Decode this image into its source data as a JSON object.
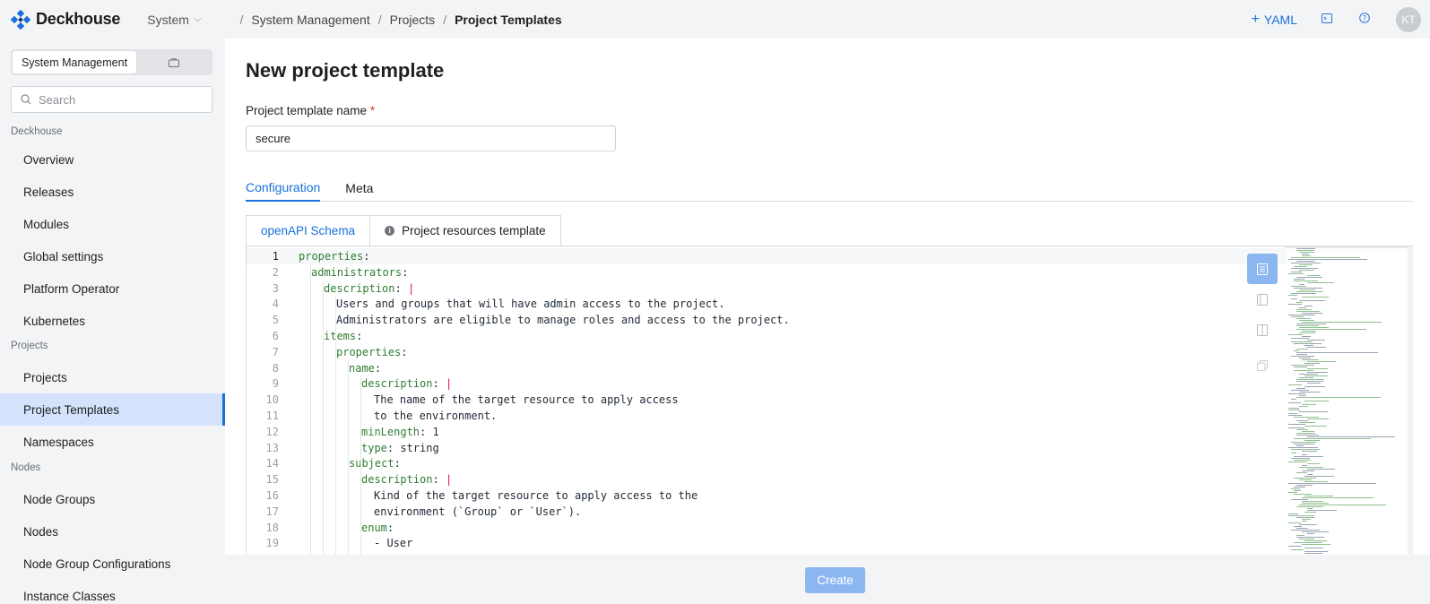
{
  "header": {
    "logo_text": "Deckhouse",
    "system_select": "System",
    "breadcrumbs": [
      "System Management",
      "Projects",
      "Project Templates"
    ],
    "yaml_label": "YAML",
    "avatar_initials": "KT"
  },
  "sidebar": {
    "segment_active": "System Management",
    "search_placeholder": "Search",
    "sections": {
      "deckhouse": "Deckhouse",
      "projects": "Projects",
      "nodes": "Nodes"
    },
    "items": {
      "overview": "Overview",
      "releases": "Releases",
      "modules": "Modules",
      "global_settings": "Global settings",
      "platform_operator": "Platform Operator",
      "kubernetes": "Kubernetes",
      "projects": "Projects",
      "project_templates": "Project Templates",
      "namespaces": "Namespaces",
      "node_groups": "Node Groups",
      "nodes": "Nodes",
      "node_group_configurations": "Node Group Configurations",
      "instance_classes": "Instance Classes"
    },
    "active_item": "Project Templates"
  },
  "main": {
    "title": "New project template",
    "name_label": "Project template name",
    "name_required_mark": "*",
    "name_value": "secure",
    "tabs": [
      "Configuration",
      "Meta"
    ],
    "active_tab": "Configuration",
    "subtabs": [
      "openAPI Schema",
      "Project resources template"
    ],
    "active_subtab": "openAPI Schema",
    "info_glyph": "i"
  },
  "editor": {
    "lines": [
      {
        "n": "1",
        "indent": 0,
        "key": "properties",
        "rest": "",
        "pipe": false,
        "plain": ""
      },
      {
        "n": "2",
        "indent": 1,
        "key": "administrators",
        "rest": "",
        "pipe": false,
        "plain": ""
      },
      {
        "n": "3",
        "indent": 2,
        "key": "description",
        "rest": "",
        "pipe": true,
        "plain": ""
      },
      {
        "n": "4",
        "indent": 3,
        "key": "",
        "rest": "",
        "pipe": false,
        "plain": "Users and groups that will have admin access to the project."
      },
      {
        "n": "5",
        "indent": 3,
        "key": "",
        "rest": "",
        "pipe": false,
        "plain": "Administrators are eligible to manage roles and access to the project."
      },
      {
        "n": "6",
        "indent": 2,
        "key": "items",
        "rest": "",
        "pipe": false,
        "plain": ""
      },
      {
        "n": "7",
        "indent": 3,
        "key": "properties",
        "rest": "",
        "pipe": false,
        "plain": ""
      },
      {
        "n": "8",
        "indent": 4,
        "key": "name",
        "rest": "",
        "pipe": false,
        "plain": ""
      },
      {
        "n": "9",
        "indent": 5,
        "key": "description",
        "rest": "",
        "pipe": true,
        "plain": ""
      },
      {
        "n": "10",
        "indent": 6,
        "key": "",
        "rest": "",
        "pipe": false,
        "plain": "The name of the target resource to apply access"
      },
      {
        "n": "11",
        "indent": 6,
        "key": "",
        "rest": "",
        "pipe": false,
        "plain": "to the environment."
      },
      {
        "n": "12",
        "indent": 5,
        "key": "minLength",
        "rest": " 1",
        "pipe": false,
        "plain": ""
      },
      {
        "n": "13",
        "indent": 5,
        "key": "type",
        "rest": " string",
        "pipe": false,
        "plain": ""
      },
      {
        "n": "14",
        "indent": 4,
        "key": "subject",
        "rest": "",
        "pipe": false,
        "plain": ""
      },
      {
        "n": "15",
        "indent": 5,
        "key": "description",
        "rest": "",
        "pipe": true,
        "plain": ""
      },
      {
        "n": "16",
        "indent": 6,
        "key": "",
        "rest": "",
        "pipe": false,
        "plain": "Kind of the target resource to apply access to the"
      },
      {
        "n": "17",
        "indent": 6,
        "key": "",
        "rest": "",
        "pipe": false,
        "plain": "environment (`Group` or `User`)."
      },
      {
        "n": "18",
        "indent": 5,
        "key": "enum",
        "rest": "",
        "pipe": false,
        "plain": ""
      },
      {
        "n": "19",
        "indent": 6,
        "key": "",
        "rest": "",
        "pipe": false,
        "plain": "- User"
      }
    ]
  },
  "footer": {
    "create_label": "Create"
  },
  "colors": {
    "accent": "#1a6fdc",
    "yaml_key": "#2f7d32",
    "pipe": "#dd1144",
    "active_nav_bg": "#d4e3fb",
    "create_button": "#8cb6ef"
  },
  "icons": {
    "logo": "deckhouse-logo-icon",
    "plus": "plus-icon",
    "terminal": "terminal-icon",
    "help": "help-icon",
    "search": "search-icon",
    "segment": "folder-icon",
    "editor_tools": [
      "document-view-icon",
      "split-left-icon",
      "split-columns-icon",
      "copy-icon"
    ]
  }
}
